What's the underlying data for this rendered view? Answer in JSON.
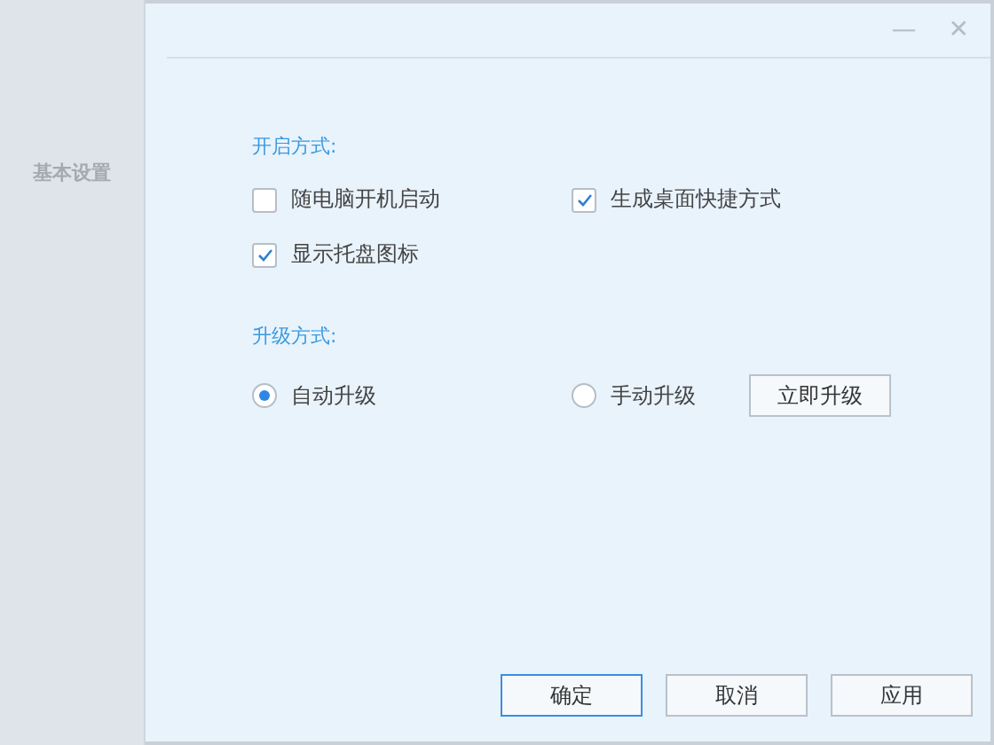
{
  "sidebar": {
    "items": [
      {
        "label": "基本设置",
        "selected": false
      }
    ]
  },
  "window": {
    "controls": [
      "—",
      "✕"
    ]
  },
  "sections": [
    {
      "title": "开启方式:",
      "options": [
        {
          "kind": "checkbox",
          "label": "随电脑开机启动",
          "checked": false
        },
        {
          "kind": "checkbox",
          "label": "生成桌面快捷方式",
          "checked": true
        },
        {
          "kind": "checkbox",
          "label": "显示托盘图标",
          "checked": true
        }
      ]
    },
    {
      "title": "升级方式:",
      "options": [
        {
          "kind": "radio",
          "label": "自动升级",
          "selected": true
        },
        {
          "kind": "radio",
          "label": "手动升级",
          "selected": false
        },
        {
          "kind": "button",
          "label": "立即升级"
        }
      ]
    }
  ],
  "buttons": [
    {
      "label": "确定",
      "primary": true
    },
    {
      "label": "取消",
      "primary": false
    },
    {
      "label": "应用",
      "primary": false
    }
  ]
}
